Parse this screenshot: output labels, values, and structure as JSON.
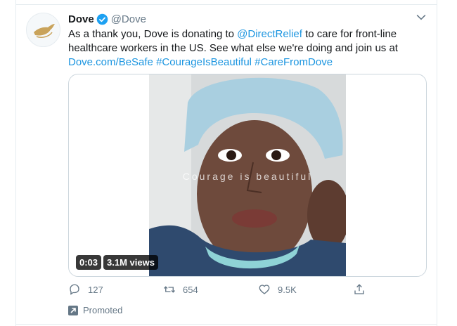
{
  "tweet": {
    "display_name": "Dove",
    "handle": "@Dove",
    "text_before": "As a thank you, Dove is donating to ",
    "mention": "@DirectRelief",
    "text_after": " to care for front-line healthcare workers in the US. See what else we're doing and join us at ",
    "link": "Dove.com/BeSafe",
    "hashtags": "#CourageIsBeautiful #CareFromDove"
  },
  "video": {
    "overlay_text": "Courage is beautiful",
    "duration": "0:03",
    "views": "3.1M views"
  },
  "actions": {
    "replies": "127",
    "retweets": "654",
    "likes": "9.5K"
  },
  "promoted_label": "Promoted",
  "colors": {
    "link": "#1b95e0",
    "muted": "#657786",
    "border": "#e6ecf0",
    "verified": "#1da1f2"
  }
}
